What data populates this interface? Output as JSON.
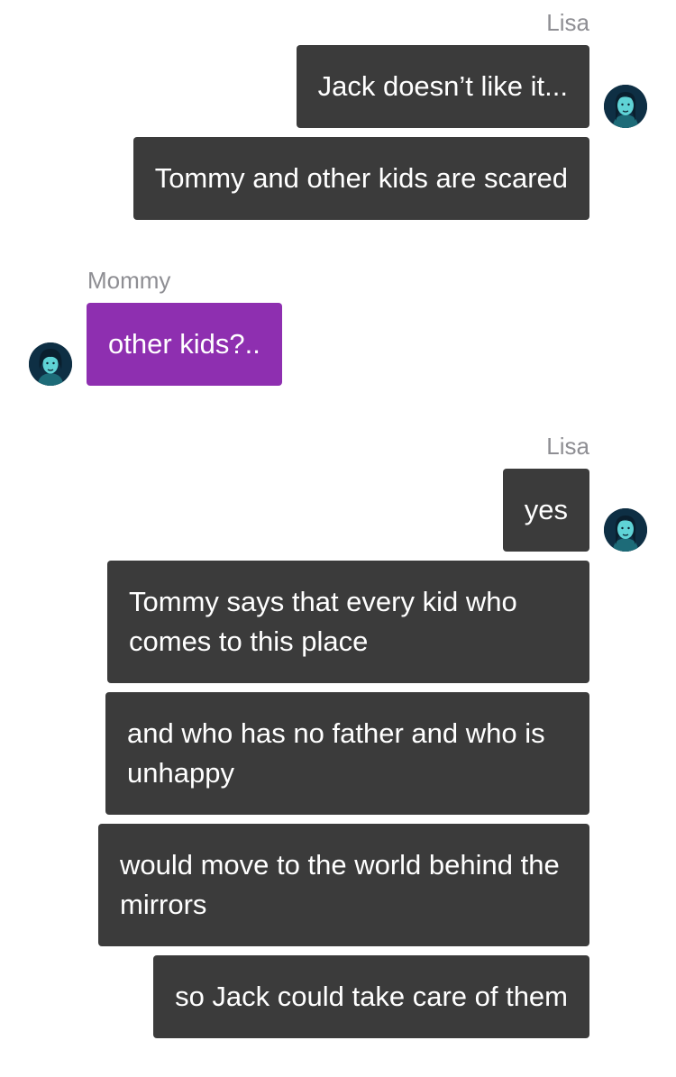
{
  "conversation": {
    "groups": [
      {
        "sender": "Lisa",
        "avatar_icon": "lisa-avatar-icon",
        "messages": [
          "Jack doesn’t like it...",
          "Tommy and other kids are scared"
        ]
      },
      {
        "sender": "Mommy",
        "avatar_icon": "mommy-avatar-icon",
        "messages": [
          "other kids?.."
        ]
      },
      {
        "sender": "Lisa",
        "avatar_icon": "lisa-avatar-icon",
        "messages": [
          "yes",
          "Tommy says that every kid who comes to this place",
          "and who has no father and who is unhappy",
          "would move to the world behind the mirrors",
          "so Jack could take care of them"
        ]
      }
    ]
  },
  "colors": {
    "outgoing_bubble": "#3b3b3b",
    "incoming_bubble": "#8e2fb0",
    "sender_name": "#8e8e93",
    "bubble_text": "#ffffff",
    "avatar_bg": "#0e2f44",
    "avatar_face": "#5fd3d6"
  }
}
